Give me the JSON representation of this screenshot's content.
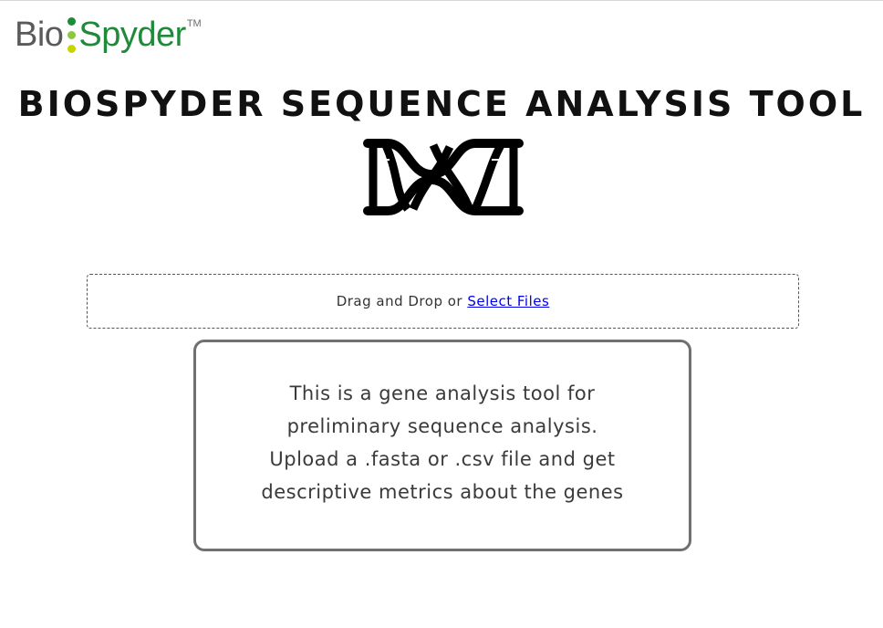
{
  "brand": {
    "logo_part1": "Bio",
    "logo_part2": "Spyder",
    "trademark": "TM",
    "colors": {
      "grey": "#5a5a5a",
      "green": "#1f8a3a",
      "dot_top": "#1f8a3a",
      "dot_middle": "#8dc63f",
      "dot_bottom": "#c8d400"
    }
  },
  "header": {
    "title": "BIOSPYDER SEQUENCE ANALYSIS TOOL",
    "icon": "dna-icon"
  },
  "upload": {
    "prompt": "Drag and Drop or ",
    "link_label": "Select Files",
    "link_color": "#0000ee"
  },
  "info": {
    "lines": [
      "This is a gene analysis tool for",
      "preliminary sequence analysis.",
      "Upload a .fasta or .csv file and get",
      "descriptive metrics about the genes"
    ]
  }
}
